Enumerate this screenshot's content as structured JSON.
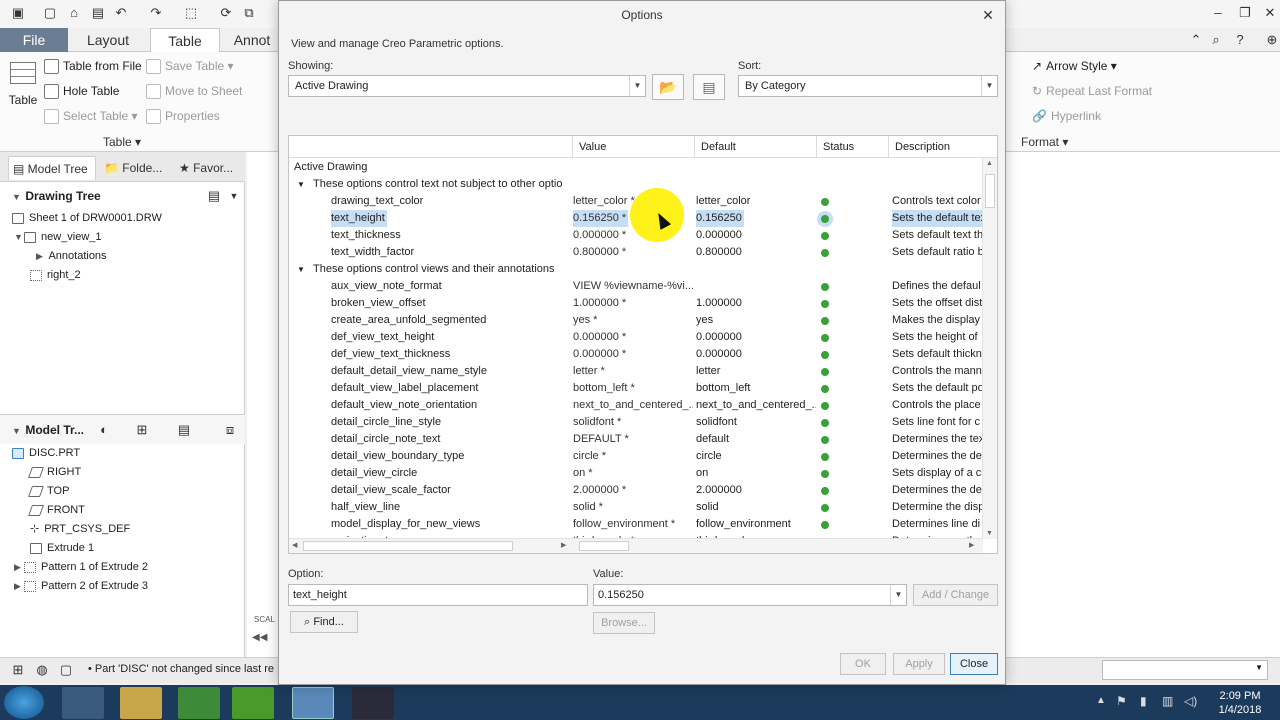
{
  "app": {
    "tabs": [
      "File",
      "Layout",
      "Table",
      "Annot"
    ],
    "active_tab": "Table",
    "ribbon": {
      "table_group": {
        "table_label": "Table",
        "table_from_file": "Table from File",
        "save_table": "Save Table",
        "hole_table": "Hole Table",
        "move_to_sheet": "Move to Sheet",
        "select_table": "Select Table",
        "properties": "Properties",
        "group_label": "Table"
      },
      "right_group": {
        "arrow_style": "Arrow Style",
        "repeat_last_format": "Repeat Last Format",
        "hyperlink": "Hyperlink",
        "format_label": "Format"
      }
    },
    "left_panel": {
      "tabs": [
        "Model Tree",
        "Folde...",
        "Favor..."
      ],
      "drawing_tree_title": "Drawing Tree",
      "drawing_tree": [
        "Sheet 1 of DRW0001.DRW",
        "new_view_1",
        "Annotations",
        "right_2"
      ],
      "model_tree_title": "Model Tr...",
      "model_tree": [
        "DISC.PRT",
        "RIGHT",
        "TOP",
        "FRONT",
        "PRT_CSYS_DEF",
        "Extrude 1",
        "Pattern 1 of Extrude 2",
        "Pattern 2 of Extrude 3"
      ]
    },
    "status_message": "Part 'DISC' not changed since last re",
    "scale_label": "SCAL",
    "clock": {
      "time": "2:09 PM",
      "date": "1/4/2018"
    }
  },
  "dialog": {
    "title": "Options",
    "subtitle": "View and manage Creo Parametric options.",
    "showing_label": "Showing:",
    "showing_value": "Active Drawing",
    "sort_label": "Sort:",
    "sort_value": "By Category",
    "columns": [
      "Value",
      "Default",
      "Status",
      "Description"
    ],
    "root_label": "Active Drawing",
    "groups": [
      {
        "title": "These options control text not subject to other optio",
        "rows": [
          {
            "name": "drawing_text_color",
            "value": "letter_color *",
            "default": "letter_color",
            "desc": "Controls text color"
          },
          {
            "name": "text_height",
            "value": "0.156250 *",
            "default": "0.156250",
            "desc": "Sets the default tex",
            "selected": true
          },
          {
            "name": "text_thickness",
            "value": "0.000000 *",
            "default": "0.000000",
            "desc": "Sets default text th"
          },
          {
            "name": "text_width_factor",
            "value": "0.800000 *",
            "default": "0.800000",
            "desc": "Sets default ratio b"
          }
        ]
      },
      {
        "title": "These options control views and their annotations",
        "rows": [
          {
            "name": "aux_view_note_format",
            "value": "VIEW %viewname-%vi...",
            "default": "",
            "desc": "Defines the defaul"
          },
          {
            "name": "broken_view_offset",
            "value": "1.000000 *",
            "default": "1.000000",
            "desc": "Sets the offset dist"
          },
          {
            "name": "create_area_unfold_segmented",
            "value": "yes *",
            "default": "yes",
            "desc": "Makes the display"
          },
          {
            "name": "def_view_text_height",
            "value": "0.000000 *",
            "default": "0.000000",
            "desc": "Sets the height of"
          },
          {
            "name": "def_view_text_thickness",
            "value": "0.000000 *",
            "default": "0.000000",
            "desc": "Sets default thickn"
          },
          {
            "name": "default_detail_view_name_style",
            "value": "letter *",
            "default": "letter",
            "desc": "Controls the mann"
          },
          {
            "name": "default_view_label_placement",
            "value": "bottom_left *",
            "default": "bottom_left",
            "desc": "Sets the default po"
          },
          {
            "name": "default_view_note_orientation",
            "value": "next_to_and_centered_...",
            "default": "next_to_and_centered_...",
            "desc": "Controls the place"
          },
          {
            "name": "detail_circle_line_style",
            "value": "solidfont *",
            "default": "solidfont",
            "desc": "Sets line font for c"
          },
          {
            "name": "detail_circle_note_text",
            "value": "DEFAULT *",
            "default": "default",
            "desc": "Determines the tex"
          },
          {
            "name": "detail_view_boundary_type",
            "value": "circle *",
            "default": "circle",
            "desc": "Determines the de"
          },
          {
            "name": "detail_view_circle",
            "value": "on *",
            "default": "on",
            "desc": "Sets display of a ci"
          },
          {
            "name": "detail_view_scale_factor",
            "value": "2.000000 *",
            "default": "2.000000",
            "desc": "Determines the de"
          },
          {
            "name": "half_view_line",
            "value": "solid *",
            "default": "solid",
            "desc": "Determine the disp"
          },
          {
            "name": "model_display_for_new_views",
            "value": "follow_environment *",
            "default": "follow_environment",
            "desc": "Determines line di"
          },
          {
            "name": "projection_type",
            "value": "third_angle *",
            "default": "third_angle",
            "desc": "Determines metho"
          }
        ]
      }
    ],
    "option_label": "Option:",
    "option_value": "text_height",
    "value_label": "Value:",
    "value_value": "0.156250",
    "add_change": "Add / Change",
    "find": "Find...",
    "browse": "Browse...",
    "ok": "OK",
    "apply": "Apply",
    "close": "Close"
  },
  "colors": {
    "selection": "#c6def5",
    "status_ok": "#3aa03a",
    "file_tab": "#6b7d93",
    "taskbar": "#1b3a5c",
    "highlight": "#ffef00"
  }
}
